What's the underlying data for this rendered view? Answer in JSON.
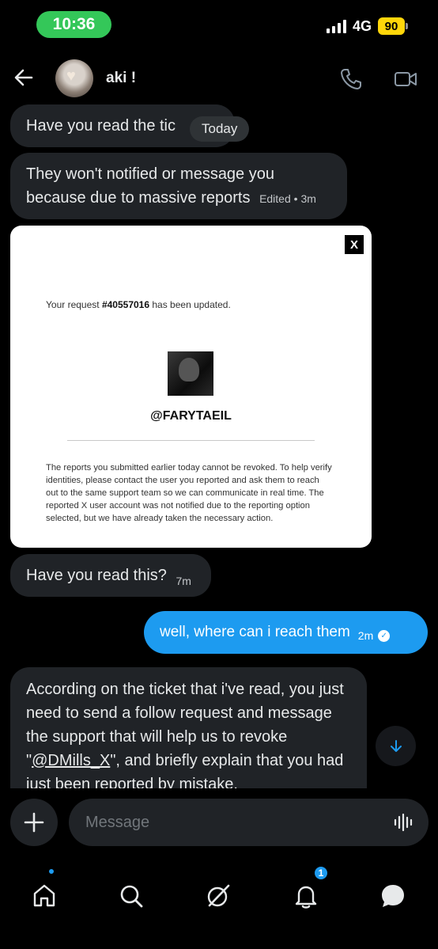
{
  "status_bar": {
    "time": "10:36",
    "network": "4G",
    "battery": "90"
  },
  "header": {
    "contact_name": "aki !"
  },
  "messages": [
    {
      "text": "Have  you read the tic",
      "meta": ""
    },
    {
      "text": "They won't notified or message you because due to massive reports",
      "meta": "Edited • 3m"
    },
    {
      "text": "Have you read this?",
      "meta": "7m"
    },
    {
      "text": "well, where can i reach them",
      "meta": "2m"
    },
    {
      "text_before": "According on the ticket that i've read, you just need to send a follow request and message the support that will help us to revoke \"",
      "mention": "@DMills_X",
      "text_after": "\", and briefly explain that you had just been reported by mistake."
    }
  ],
  "date_pill": "Today",
  "attachment": {
    "x_logo": "X",
    "request_prefix": "Your request ",
    "request_id": "#40557016",
    "request_suffix": " has been updated.",
    "handle": "@FARYTAEIL",
    "body": "The reports you submitted earlier today cannot be revoked. To help verify identities, please contact the user you reported and ask them to reach out to the same support team so we can communicate in real time. The reported X user account was not notified due to the reporting option selected, but we have already taken the necessary action."
  },
  "composer": {
    "placeholder": "Message"
  },
  "nav": {
    "notifications_badge": "1"
  },
  "colors": {
    "accent": "#1d9bf0",
    "bubble_received": "#202327",
    "background": "#000000"
  }
}
